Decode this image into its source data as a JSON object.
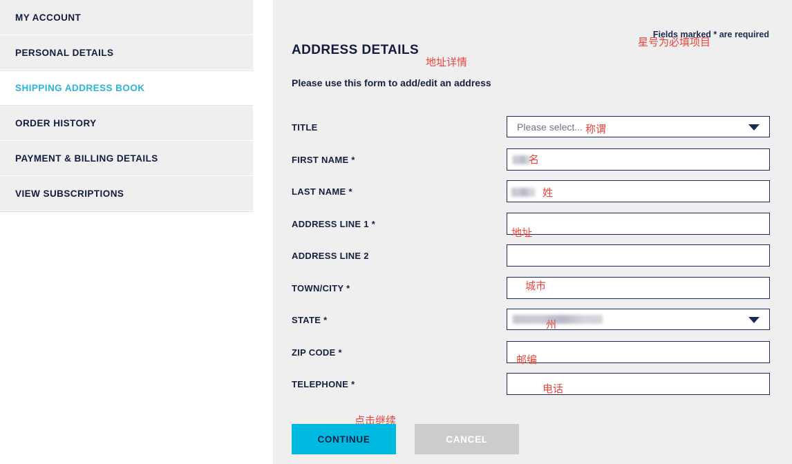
{
  "sidebar": {
    "items": [
      {
        "label": "MY ACCOUNT",
        "active": false
      },
      {
        "label": "PERSONAL DETAILS",
        "active": false
      },
      {
        "label": "SHIPPING ADDRESS BOOK",
        "active": true
      },
      {
        "label": "ORDER HISTORY",
        "active": false
      },
      {
        "label": "PAYMENT & BILLING DETAILS",
        "active": false
      },
      {
        "label": "VIEW SUBSCRIPTIONS",
        "active": false
      }
    ]
  },
  "main": {
    "title": "ADDRESS DETAILS",
    "title_annotation_cn": "地址详情",
    "subtitle": "Please use this form to add/edit an address",
    "required_note": "Fields marked * are required",
    "required_note_annotation_cn": "星号为必填项目"
  },
  "form": {
    "fields": [
      {
        "label": "TITLE",
        "type": "select",
        "value": "Please select...",
        "annotation_cn": "称谓",
        "redacted": false
      },
      {
        "label": "FIRST NAME *",
        "type": "text",
        "value": "",
        "annotation_cn": "名",
        "redacted": true
      },
      {
        "label": "LAST NAME *",
        "type": "text",
        "value": "",
        "annotation_cn": "姓",
        "redacted": true
      },
      {
        "label": "ADDRESS LINE 1 *",
        "type": "text",
        "value": "",
        "annotation_cn": "地址",
        "redacted": false
      },
      {
        "label": "ADDRESS LINE 2",
        "type": "text",
        "value": "",
        "annotation_cn": "",
        "redacted": false
      },
      {
        "label": "TOWN/CITY *",
        "type": "text",
        "value": "",
        "annotation_cn": "城市",
        "redacted": false
      },
      {
        "label": "STATE *",
        "type": "select",
        "value": "",
        "annotation_cn": "州",
        "redacted": true
      },
      {
        "label": "ZIP CODE *",
        "type": "text",
        "value": "",
        "annotation_cn": "邮编",
        "redacted": false
      },
      {
        "label": "TELEPHONE *",
        "type": "text",
        "value": "",
        "annotation_cn": "电话",
        "redacted": false
      }
    ]
  },
  "buttons": {
    "continue_label": "CONTINUE",
    "continue_annotation_cn": "点击继续",
    "cancel_label": "CANCEL"
  },
  "colors": {
    "accent_cyan": "#00b9e0",
    "active_nav": "#29b6d8",
    "navy": "#15203f",
    "panel_bg": "#efefef",
    "nav_bg": "#efefef",
    "cancel_gray": "#cccccc",
    "annotation_red": "#e8453c"
  }
}
